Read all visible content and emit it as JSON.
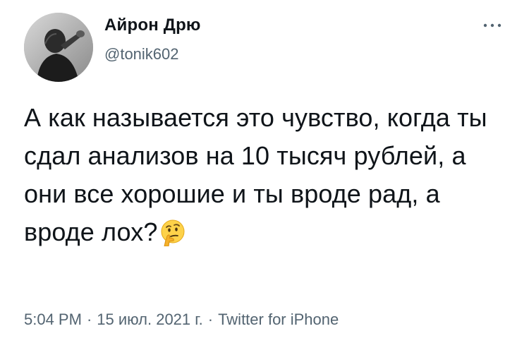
{
  "tweet": {
    "author": {
      "name": "Айрон Дрю",
      "handle": "@tonik602"
    },
    "text": "А как называется это чувство, когда ты сдал анализов на 10 тысяч рублей, а они все хорошие и ты вроде рад, а вроде лох?",
    "emoji": "thinking-face-emoji",
    "time": "5:04 PM",
    "date": "15 июл. 2021 г.",
    "separator": "·",
    "source": "Twitter for iPhone"
  },
  "icons": {
    "more": "more-horizontal-icon"
  }
}
